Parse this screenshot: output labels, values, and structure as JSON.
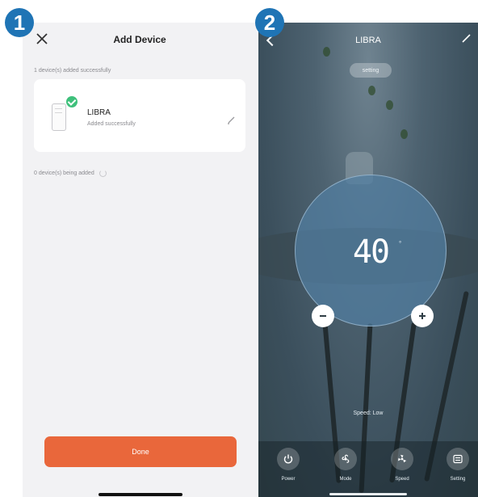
{
  "badges": {
    "step1": "1",
    "step2": "2"
  },
  "add_device": {
    "title": "Add Device",
    "success_summary": "1 device(s) added successfully",
    "device": {
      "name": "LIBRA",
      "status": "Added successfully"
    },
    "being_added": "0 device(s) being added",
    "done_label": "Done"
  },
  "control": {
    "title": "LIBRA",
    "setting_label": "setting",
    "value": "40",
    "unit": "°",
    "speed_text": "Speed: Low",
    "tabs": [
      {
        "label": "Power",
        "icon": "power-icon"
      },
      {
        "label": "Mode",
        "icon": "mode-icon"
      },
      {
        "label": "Speed",
        "icon": "fan-icon"
      },
      {
        "label": "Setting",
        "icon": "setting-icon"
      }
    ]
  },
  "colors": {
    "accent_orange": "#e9673b",
    "badge_blue": "#1f74b5",
    "success_green": "#3ec07b"
  }
}
